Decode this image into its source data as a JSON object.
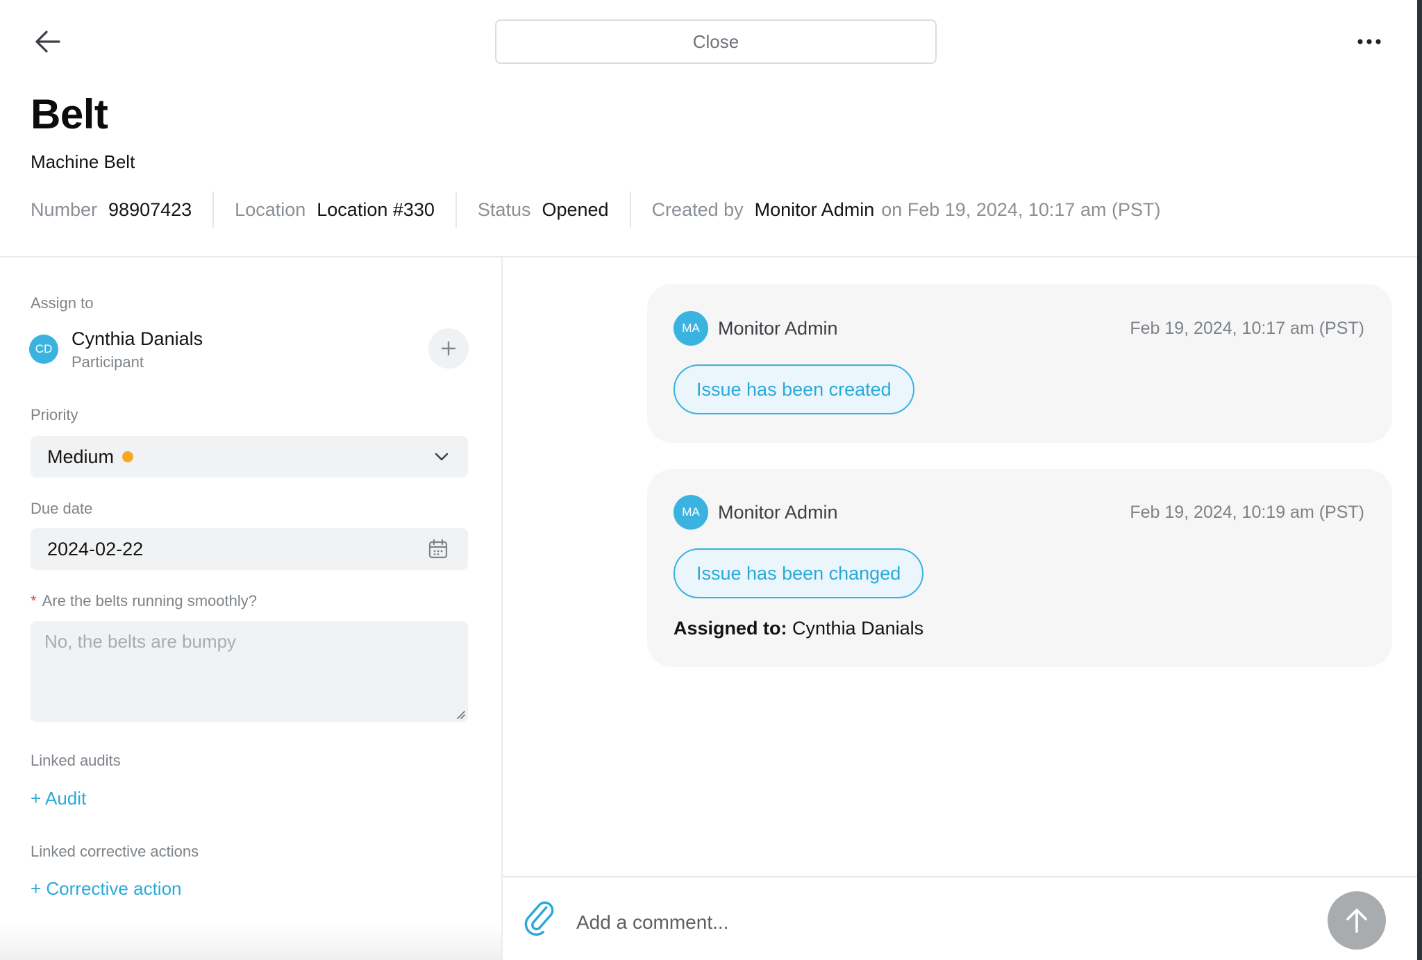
{
  "header": {
    "close_label": "Close",
    "title": "Belt",
    "subtitle": "Machine Belt",
    "meta": {
      "number_label": "Number",
      "number_value": "98907423",
      "location_label": "Location",
      "location_value": "Location #330",
      "status_label": "Status",
      "status_value": "Opened",
      "created_label": "Created by",
      "created_by": "Monitor Admin",
      "created_on": "on Feb 19, 2024, 10:17 am (PST)"
    }
  },
  "form": {
    "assign_label": "Assign to",
    "assignee": {
      "initials": "CD",
      "name": "Cynthia Danials",
      "role": "Participant"
    },
    "priority_label": "Priority",
    "priority_value": "Medium",
    "priority_color": "#f6a821",
    "due_label": "Due date",
    "due_value": "2024-02-22",
    "question_required_mark": "*",
    "question_label": "Are the belts running smoothly?",
    "question_placeholder": "No, the belts are bumpy",
    "linked_audits_label": "Linked audits",
    "add_audit_label": "+ Audit",
    "linked_actions_label": "Linked corrective actions",
    "add_action_label": "+ Corrective action"
  },
  "activity": [
    {
      "initials": "MA",
      "author": "Monitor Admin",
      "time": "Feb 19, 2024, 10:17 am (PST)",
      "event": "Issue has been created"
    },
    {
      "initials": "MA",
      "author": "Monitor Admin",
      "time": "Feb 19, 2024, 10:19 am (PST)",
      "event": "Issue has been changed",
      "detail_label": "Assigned to:",
      "detail_value": "Cynthia Danials"
    }
  ],
  "comment": {
    "placeholder": "Add a comment..."
  },
  "icons": {
    "back": "arrow-left-icon",
    "more": "ellipsis-icon",
    "add": "plus-icon",
    "chevron": "chevron-down-icon",
    "calendar": "calendar-icon",
    "attach": "paperclip-icon",
    "send": "arrow-up-icon"
  },
  "colors": {
    "accent": "#2aa9d9",
    "avatar": "#3bb3e0"
  }
}
